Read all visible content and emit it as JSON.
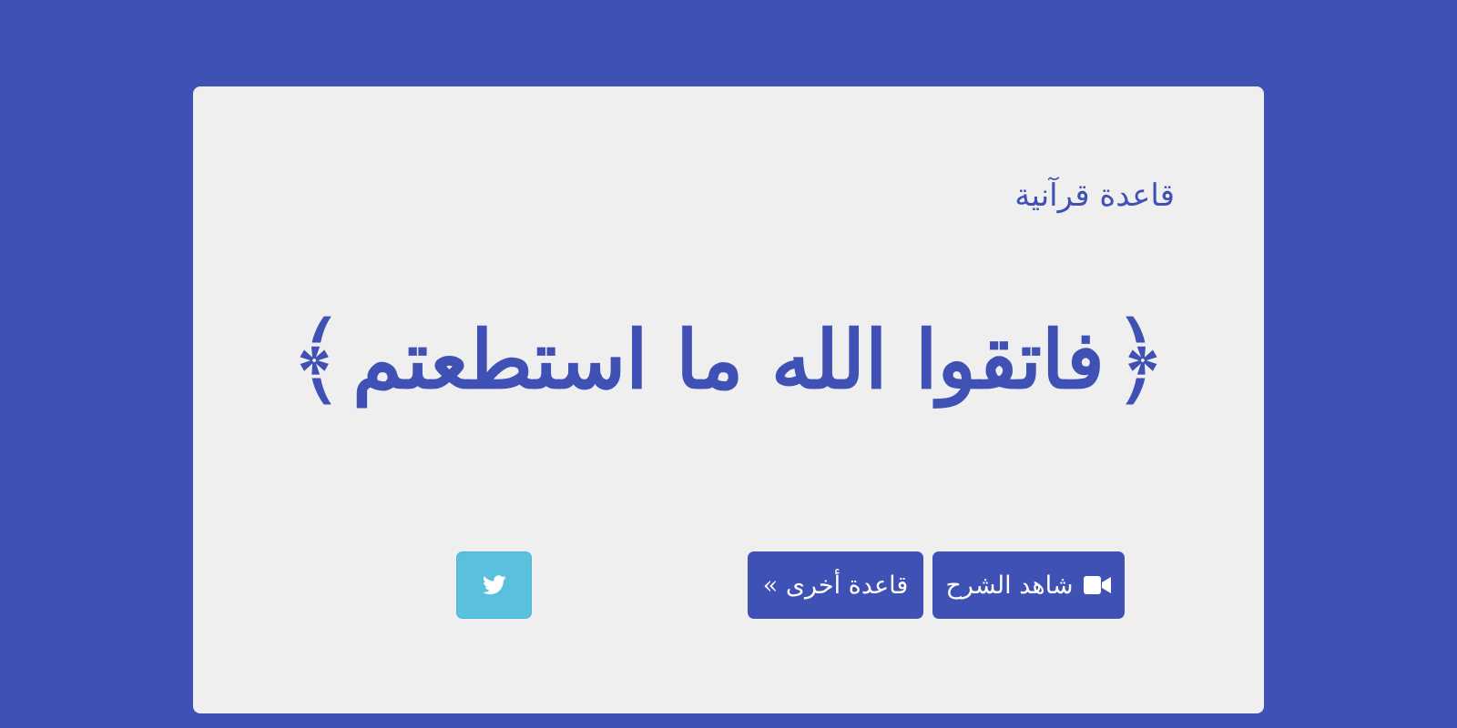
{
  "card": {
    "title": "قاعدة قرآنية",
    "verse": {
      "open_bracket": "﴿",
      "text": "فاتقوا الله ما استطعتم",
      "close_bracket": "﴾"
    }
  },
  "actions": {
    "watch_label": "شاهد الشرح",
    "next_label": "قاعدة أخرى »",
    "twitter_icon": "twitter-icon",
    "video_icon": "video-camera-icon"
  },
  "colors": {
    "background": "#3f51b5",
    "card": "#efefef",
    "primary": "#3f51b5",
    "twitter": "#5bc0de"
  }
}
